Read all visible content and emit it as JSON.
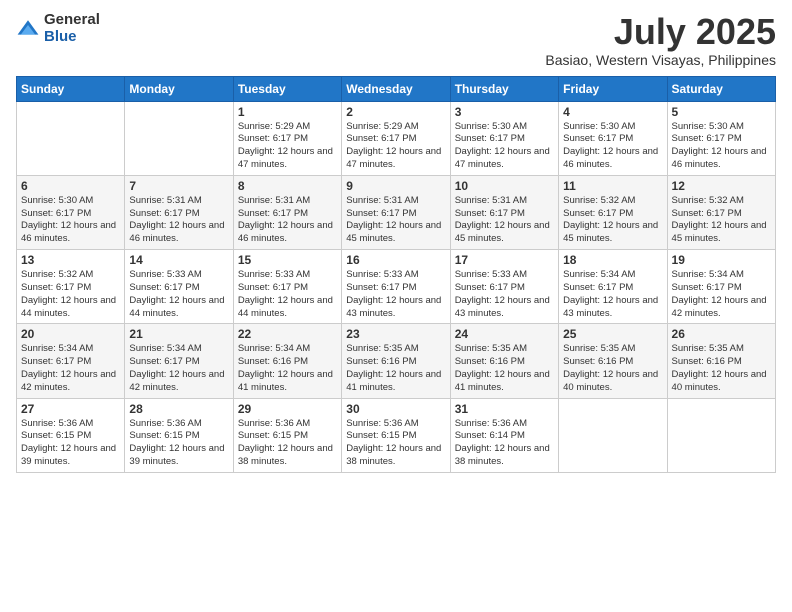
{
  "logo": {
    "general": "General",
    "blue": "Blue"
  },
  "title": "July 2025",
  "subtitle": "Basiao, Western Visayas, Philippines",
  "days_of_week": [
    "Sunday",
    "Monday",
    "Tuesday",
    "Wednesday",
    "Thursday",
    "Friday",
    "Saturday"
  ],
  "weeks": [
    [
      {
        "day": "",
        "sunrise": "",
        "sunset": "",
        "daylight": ""
      },
      {
        "day": "",
        "sunrise": "",
        "sunset": "",
        "daylight": ""
      },
      {
        "day": "1",
        "sunrise": "Sunrise: 5:29 AM",
        "sunset": "Sunset: 6:17 PM",
        "daylight": "Daylight: 12 hours and 47 minutes."
      },
      {
        "day": "2",
        "sunrise": "Sunrise: 5:29 AM",
        "sunset": "Sunset: 6:17 PM",
        "daylight": "Daylight: 12 hours and 47 minutes."
      },
      {
        "day": "3",
        "sunrise": "Sunrise: 5:30 AM",
        "sunset": "Sunset: 6:17 PM",
        "daylight": "Daylight: 12 hours and 47 minutes."
      },
      {
        "day": "4",
        "sunrise": "Sunrise: 5:30 AM",
        "sunset": "Sunset: 6:17 PM",
        "daylight": "Daylight: 12 hours and 46 minutes."
      },
      {
        "day": "5",
        "sunrise": "Sunrise: 5:30 AM",
        "sunset": "Sunset: 6:17 PM",
        "daylight": "Daylight: 12 hours and 46 minutes."
      }
    ],
    [
      {
        "day": "6",
        "sunrise": "Sunrise: 5:30 AM",
        "sunset": "Sunset: 6:17 PM",
        "daylight": "Daylight: 12 hours and 46 minutes."
      },
      {
        "day": "7",
        "sunrise": "Sunrise: 5:31 AM",
        "sunset": "Sunset: 6:17 PM",
        "daylight": "Daylight: 12 hours and 46 minutes."
      },
      {
        "day": "8",
        "sunrise": "Sunrise: 5:31 AM",
        "sunset": "Sunset: 6:17 PM",
        "daylight": "Daylight: 12 hours and 46 minutes."
      },
      {
        "day": "9",
        "sunrise": "Sunrise: 5:31 AM",
        "sunset": "Sunset: 6:17 PM",
        "daylight": "Daylight: 12 hours and 45 minutes."
      },
      {
        "day": "10",
        "sunrise": "Sunrise: 5:31 AM",
        "sunset": "Sunset: 6:17 PM",
        "daylight": "Daylight: 12 hours and 45 minutes."
      },
      {
        "day": "11",
        "sunrise": "Sunrise: 5:32 AM",
        "sunset": "Sunset: 6:17 PM",
        "daylight": "Daylight: 12 hours and 45 minutes."
      },
      {
        "day": "12",
        "sunrise": "Sunrise: 5:32 AM",
        "sunset": "Sunset: 6:17 PM",
        "daylight": "Daylight: 12 hours and 45 minutes."
      }
    ],
    [
      {
        "day": "13",
        "sunrise": "Sunrise: 5:32 AM",
        "sunset": "Sunset: 6:17 PM",
        "daylight": "Daylight: 12 hours and 44 minutes."
      },
      {
        "day": "14",
        "sunrise": "Sunrise: 5:33 AM",
        "sunset": "Sunset: 6:17 PM",
        "daylight": "Daylight: 12 hours and 44 minutes."
      },
      {
        "day": "15",
        "sunrise": "Sunrise: 5:33 AM",
        "sunset": "Sunset: 6:17 PM",
        "daylight": "Daylight: 12 hours and 44 minutes."
      },
      {
        "day": "16",
        "sunrise": "Sunrise: 5:33 AM",
        "sunset": "Sunset: 6:17 PM",
        "daylight": "Daylight: 12 hours and 43 minutes."
      },
      {
        "day": "17",
        "sunrise": "Sunrise: 5:33 AM",
        "sunset": "Sunset: 6:17 PM",
        "daylight": "Daylight: 12 hours and 43 minutes."
      },
      {
        "day": "18",
        "sunrise": "Sunrise: 5:34 AM",
        "sunset": "Sunset: 6:17 PM",
        "daylight": "Daylight: 12 hours and 43 minutes."
      },
      {
        "day": "19",
        "sunrise": "Sunrise: 5:34 AM",
        "sunset": "Sunset: 6:17 PM",
        "daylight": "Daylight: 12 hours and 42 minutes."
      }
    ],
    [
      {
        "day": "20",
        "sunrise": "Sunrise: 5:34 AM",
        "sunset": "Sunset: 6:17 PM",
        "daylight": "Daylight: 12 hours and 42 minutes."
      },
      {
        "day": "21",
        "sunrise": "Sunrise: 5:34 AM",
        "sunset": "Sunset: 6:17 PM",
        "daylight": "Daylight: 12 hours and 42 minutes."
      },
      {
        "day": "22",
        "sunrise": "Sunrise: 5:34 AM",
        "sunset": "Sunset: 6:16 PM",
        "daylight": "Daylight: 12 hours and 41 minutes."
      },
      {
        "day": "23",
        "sunrise": "Sunrise: 5:35 AM",
        "sunset": "Sunset: 6:16 PM",
        "daylight": "Daylight: 12 hours and 41 minutes."
      },
      {
        "day": "24",
        "sunrise": "Sunrise: 5:35 AM",
        "sunset": "Sunset: 6:16 PM",
        "daylight": "Daylight: 12 hours and 41 minutes."
      },
      {
        "day": "25",
        "sunrise": "Sunrise: 5:35 AM",
        "sunset": "Sunset: 6:16 PM",
        "daylight": "Daylight: 12 hours and 40 minutes."
      },
      {
        "day": "26",
        "sunrise": "Sunrise: 5:35 AM",
        "sunset": "Sunset: 6:16 PM",
        "daylight": "Daylight: 12 hours and 40 minutes."
      }
    ],
    [
      {
        "day": "27",
        "sunrise": "Sunrise: 5:36 AM",
        "sunset": "Sunset: 6:15 PM",
        "daylight": "Daylight: 12 hours and 39 minutes."
      },
      {
        "day": "28",
        "sunrise": "Sunrise: 5:36 AM",
        "sunset": "Sunset: 6:15 PM",
        "daylight": "Daylight: 12 hours and 39 minutes."
      },
      {
        "day": "29",
        "sunrise": "Sunrise: 5:36 AM",
        "sunset": "Sunset: 6:15 PM",
        "daylight": "Daylight: 12 hours and 38 minutes."
      },
      {
        "day": "30",
        "sunrise": "Sunrise: 5:36 AM",
        "sunset": "Sunset: 6:15 PM",
        "daylight": "Daylight: 12 hours and 38 minutes."
      },
      {
        "day": "31",
        "sunrise": "Sunrise: 5:36 AM",
        "sunset": "Sunset: 6:14 PM",
        "daylight": "Daylight: 12 hours and 38 minutes."
      },
      {
        "day": "",
        "sunrise": "",
        "sunset": "",
        "daylight": ""
      },
      {
        "day": "",
        "sunrise": "",
        "sunset": "",
        "daylight": ""
      }
    ]
  ]
}
